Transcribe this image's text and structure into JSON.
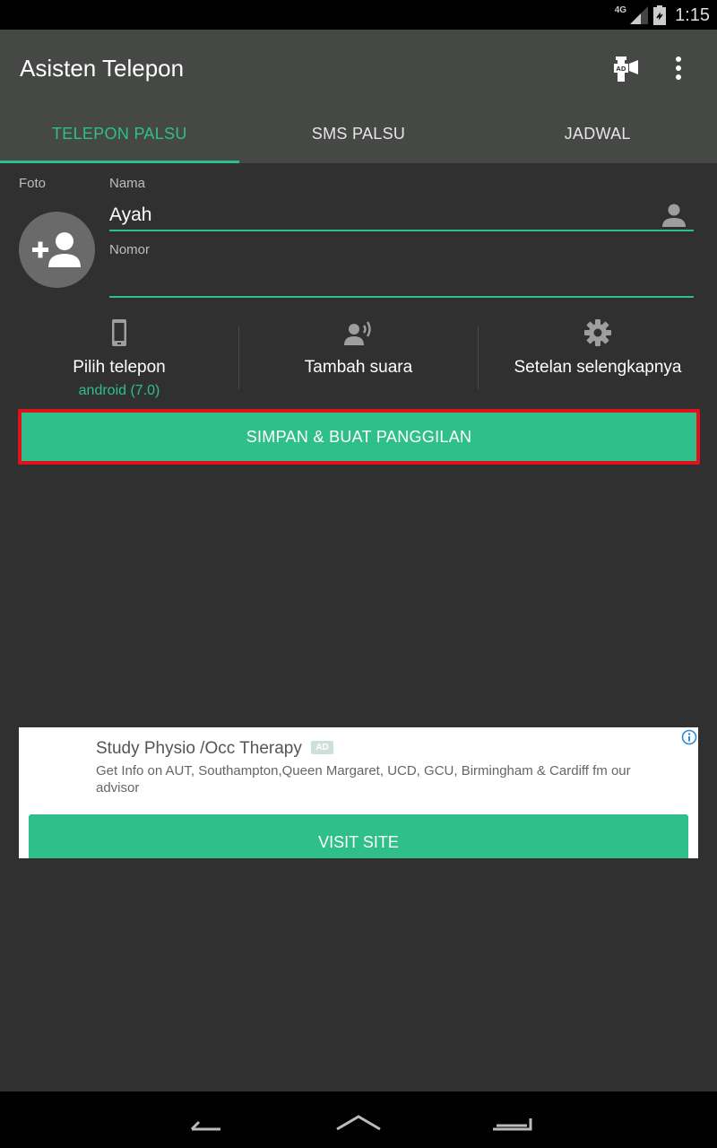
{
  "status_bar": {
    "network": "4G",
    "time": "1:15"
  },
  "app_bar": {
    "title": "Asisten Telepon",
    "ad_icon": "ad-tower-icon",
    "menu_icon": "more-vert-icon"
  },
  "tabs": [
    {
      "label": "TELEPON PALSU",
      "active": true
    },
    {
      "label": "SMS PALSU",
      "active": false
    },
    {
      "label": "JADWAL",
      "active": false
    }
  ],
  "form": {
    "photo_label": "Foto",
    "name_label": "Nama",
    "name_value": "Ayah",
    "number_label": "Nomor",
    "number_value": ""
  },
  "options": [
    {
      "icon": "phone-icon",
      "label": "Pilih telepon",
      "sub": "android (7.0)"
    },
    {
      "icon": "voice-icon",
      "label": "Tambah suara",
      "sub": ""
    },
    {
      "icon": "gear-icon",
      "label": "Setelan selengkapnya",
      "sub": ""
    }
  ],
  "primary_button": "SIMPAN & BUAT PANGGILAN",
  "ad": {
    "title": "Study Physio /Occ Therapy",
    "badge": "AD",
    "description": "Get Info on AUT, Southampton,Queen Margaret, UCD, GCU, Birmingham & Cardiff fm our advisor",
    "button": "VISIT SITE"
  },
  "colors": {
    "accent": "#2fbf8a",
    "app_bar": "#464846",
    "background": "#303030",
    "highlight_border": "#e0121b"
  }
}
